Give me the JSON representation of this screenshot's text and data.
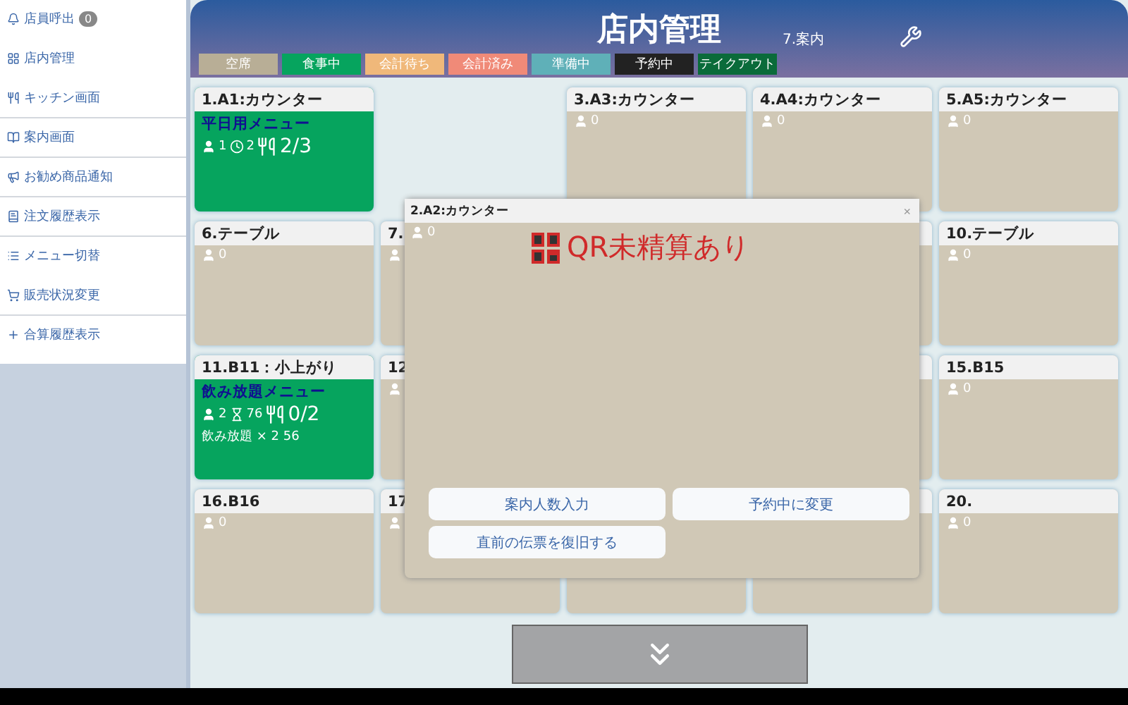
{
  "sidebar": {
    "items": [
      {
        "label": "店員呼出",
        "badge": "0",
        "separated": false
      },
      {
        "label": "店内管理",
        "separated": false
      },
      {
        "label": "キッチン画面",
        "separated": true
      },
      {
        "label": "案内画面",
        "separated": true
      },
      {
        "label": "お勧め商品通知",
        "separated": true
      },
      {
        "label": "注文履歴表示",
        "separated": true
      },
      {
        "label": "メニュー切替",
        "separated": false
      },
      {
        "label": "販売状況変更",
        "separated": true
      },
      {
        "label": "合算履歴表示",
        "separated": false
      }
    ]
  },
  "header": {
    "title": "店内管理",
    "guide": "7.案内"
  },
  "legend": [
    {
      "label": "空席",
      "color": "#b8ae96"
    },
    {
      "label": "食事中",
      "color": "#06a45e"
    },
    {
      "label": "会計待ち",
      "color": "#f0b87a"
    },
    {
      "label": "会計済み",
      "color": "#f08a78"
    },
    {
      "label": "準備中",
      "color": "#5fb0b8"
    },
    {
      "label": "予約中",
      "color": "#222222"
    },
    {
      "label": "テイクアウト",
      "color": "#0a6b3a"
    }
  ],
  "tables": [
    {
      "title": "1.A1:カウンター",
      "kind": "eating",
      "menu": "平日用メニュー",
      "people": "1",
      "time": "2",
      "dishes": "2/3"
    },
    {
      "kind": "blank"
    },
    {
      "title": "3.A3:カウンター",
      "kind": "empty",
      "guest_icon": true,
      "guests": "0"
    },
    {
      "title": "4.A4:カウンター",
      "kind": "empty",
      "guest_icon": true,
      "guests": "0"
    },
    {
      "title": "5.A5:カウンター",
      "kind": "empty",
      "guest_icon": true,
      "guests": "0"
    },
    {
      "title": "6.テーブル",
      "kind": "empty",
      "guest_icon": true,
      "guests": "0"
    },
    {
      "title": "7.",
      "kind": "empty",
      "guest_icon": true
    },
    {
      "kind": "blank"
    },
    {
      "kind": "empty"
    },
    {
      "title": "10.テーブル",
      "kind": "empty",
      "guest_icon": true,
      "guests": "0"
    },
    {
      "title": "11.B11：小上がり",
      "kind": "eating",
      "menu": "飲み放題メニュー",
      "people": "2",
      "time": "76",
      "dishes": "0/2",
      "note": "飲み放題 × 2 56"
    },
    {
      "title": "12",
      "kind": "empty",
      "guest_icon": true
    },
    {
      "kind": "blank"
    },
    {
      "kind": "empty"
    },
    {
      "title": "15.B15",
      "kind": "empty",
      "guest_icon": true,
      "guests": "0"
    },
    {
      "title": "16.B16",
      "kind": "empty",
      "guest_icon": true,
      "guests": "0"
    },
    {
      "title": "17",
      "kind": "empty",
      "guest_icon": true
    },
    {
      "kind": "empty"
    },
    {
      "kind": "empty"
    },
    {
      "title": "20.",
      "kind": "empty",
      "guest_icon": true,
      "guests": "0"
    }
  ],
  "dialog": {
    "title": "2.A2:カウンター",
    "close": "×",
    "guests": "0",
    "warning": "QR未精算あり",
    "buttons": [
      "案内人数入力",
      "予約中に変更",
      "直前の伝票を復旧する"
    ]
  }
}
